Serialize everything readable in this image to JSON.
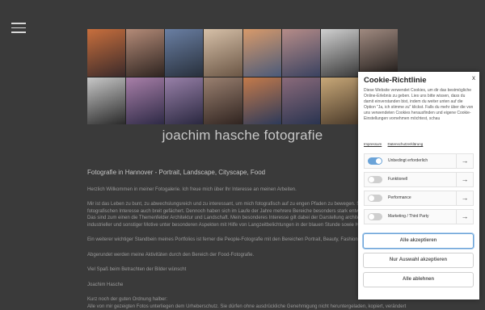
{
  "site": {
    "title": "joachim hasche fotografie"
  },
  "collage": {
    "tiles": [
      {
        "name": "photo-pier-sunset",
        "c1": "#c86f3d",
        "c2": "#3b2a2a"
      },
      {
        "name": "photo-portrait-red",
        "c1": "#b48b78",
        "c2": "#2e2420"
      },
      {
        "name": "photo-mountain-lake",
        "c1": "#6a7fa3",
        "c2": "#28303c"
      },
      {
        "name": "photo-woman-hat",
        "c1": "#d6c0a8",
        "c2": "#6b5645"
      },
      {
        "name": "photo-alps-sunrise",
        "c1": "#d89a6a",
        "c2": "#4a5a7a"
      },
      {
        "name": "photo-alps-sunrise-2",
        "c1": "#b68c88",
        "c2": "#3a4260"
      },
      {
        "name": "photo-portrait-bw",
        "c1": "#d0d0d0",
        "c2": "#3a3a3a"
      },
      {
        "name": "photo-portrait-dark",
        "c1": "#a08a80",
        "c2": "#1e1a18"
      },
      {
        "name": "photo-woman-hat-bw",
        "c1": "#c8c8c8",
        "c2": "#2a2a2a"
      },
      {
        "name": "photo-lake-reflection",
        "c1": "#a87fa8",
        "c2": "#2e2a46"
      },
      {
        "name": "photo-lake-reflection-2",
        "c1": "#9880a8",
        "c2": "#2a2840"
      },
      {
        "name": "photo-lingerie-portrait",
        "c1": "#9a8070",
        "c2": "#302420"
      },
      {
        "name": "photo-dolomites",
        "c1": "#c47a4a",
        "c2": "#2d3a5a"
      },
      {
        "name": "photo-dolomites-2",
        "c1": "#8a6a7a",
        "c2": "#2a3450"
      },
      {
        "name": "photo-woman-sunlight",
        "c1": "#c8a878",
        "c2": "#4a3a2a"
      },
      {
        "name": "photo-portrait-curly",
        "c1": "#b09a88",
        "c2": "#3a302a"
      }
    ]
  },
  "content": {
    "heading": "Fotografie in Hannover - Portrait, Landscape, Cityscape, Food",
    "p1": "Herzlich Willkommen in meiner Fotogalerie. Ich freue mich über Ihr Interesse an meinen Arbeiten.",
    "p2_l1": "Mir ist das Leben zu bunt, zu abwechslungsreich und zu interessant, um mich fotografisch auf zu engen Pfaden zu bewegen. Seit",
    "p2_l2": "fotografischen Interesse auch breit gefächert. Dennoch haben sich im Laufe der Jahre mehrere Bereiche besonders stark entwickelt",
    "p2_l3": "Das sind zum einen die Themenfelder Architektur und Landschaft. Mein besonderes Interesse gilt dabei der Darstellung architekto",
    "p2_l4": "industrieller und sonstiger Motive unter besonderen Aspekten mit Hilfe von Langzeitbelichtungen in der blauen Stunde sowie H",
    "p3": "Ein weiterer wichtiger Standbein meines Portfolios ist ferner die People-Fotografie mit den Bereichen Portrait, Beauty, Fashion, L",
    "p4": "Abgerundet werden meine Aktivitäten durch den Bereich der Food-Fotografie.",
    "p5": "Viel Spaß beim Betrachten der Bilder wünscht",
    "p6": "Joachim Hasche",
    "p7_l1": "Kurz noch der guten Ordnung halber:",
    "p7_l2": "Alle von mir gezeigten Fotos unterliegen dem Urheberschutz. Sie dürfen ohne ausdrückliche Genehmigung nicht heruntergeladen, kopiert, verändert"
  },
  "cookie": {
    "title": "Cookie-Richtlinie",
    "close": "x",
    "description": "Diese Website verwendet Cookies, um dir das bestmögliche Online-Erlebnis zu geben. Lies uns bitte wissen, dass du damit einverstanden bist, indem du weiter unten auf die Option \"Ja, ich stimme zu\" klickst. Falls du mehr über die von uns verwendeten Cookies herausfinden und eigene Cookie-Einstellungen vornehmen möchtest, schau",
    "link_impressum": "Impressum",
    "link_datenschutz": "Datenschutzerklärung",
    "categories": [
      {
        "label": "Unbedingt erforderlich",
        "enabled": true
      },
      {
        "label": "Funktionell",
        "enabled": false
      },
      {
        "label": "Performance",
        "enabled": false
      },
      {
        "label": "Marketing / Third Party",
        "enabled": false
      }
    ],
    "arrow": "→",
    "btn_accept_all": "Alle akzeptieren",
    "btn_accept_selection": "Nur Auswahl akzeptieren",
    "btn_reject_all": "Alle ablehnen"
  }
}
